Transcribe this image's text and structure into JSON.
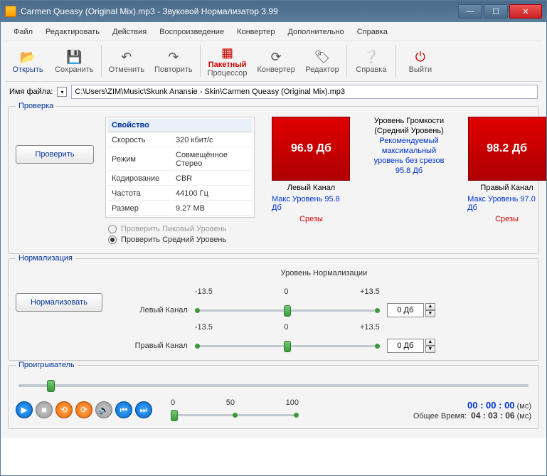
{
  "title": "Carmen Queasy (Original Mix).mp3 - Звуковой Нормализатор 3.99",
  "winbtns": {
    "min": "—",
    "max": "☐",
    "close": "✕"
  },
  "menu": [
    "Файл",
    "Редактировать",
    "Действия",
    "Воспроизведение",
    "Конвертер",
    "Дополнительно",
    "Справка"
  ],
  "toolbar": [
    {
      "label": "Открыть",
      "icon": "📂"
    },
    {
      "label": "Сохранить",
      "icon": "💾"
    },
    {
      "label": "Отменить",
      "icon": "↶"
    },
    {
      "label": "Повторить",
      "icon": "↷"
    },
    {
      "label": "Пакетный",
      "label2": "Процессор",
      "icon": "▦"
    },
    {
      "label": "Конвертер",
      "icon": "⟳"
    },
    {
      "label": "Редактор",
      "icon": "🏷"
    },
    {
      "label": "Справка",
      "icon": "❔"
    },
    {
      "label": "Выйти",
      "icon": "⏻"
    }
  ],
  "file": {
    "label": "Имя файла:",
    "path": "C:\\Users\\ZIM\\Music\\Skunk Anansie - Skin\\Carmen Queasy (Original Mix).mp3"
  },
  "check": {
    "legend": "Проверка",
    "btn": "Проверить",
    "props_header": "Свойство",
    "props": [
      [
        "Скорость",
        "320 кбит/с"
      ],
      [
        "Режим",
        "Совмещённое Стерео"
      ],
      [
        "Кодирование",
        "CBR"
      ],
      [
        "Частота",
        "44100 Гц"
      ],
      [
        "Размер",
        "9.27 MB"
      ]
    ],
    "radio_peak": "Проверить Пиковый Уровень",
    "radio_avg": "Проверить Средний Уровень",
    "left_db": "96.9 Дб",
    "right_db": "98.2 Дб",
    "left_ch": "Левый Канал",
    "right_ch": "Правый Канал",
    "left_max": "Макс Уровень 95.8 Дб",
    "right_max": "Макс Уровень 97.0 Дб",
    "clips": "Срезы",
    "loud_title": "Уровень Громкости",
    "loud_sub": "(Средний Уровень)",
    "loud_rec1": "Рекомендуемый",
    "loud_rec2": "максимальный",
    "loud_rec3": "уровень без срезов",
    "loud_val": "95.8 Дб"
  },
  "norm": {
    "legend": "Нормализация",
    "btn": "Нормализовать",
    "title": "Уровень Нормализации",
    "tick_low": "-13.5",
    "tick_mid": "0",
    "tick_high": "+13.5",
    "left_lbl": "Левый Канал",
    "right_lbl": "Правый Канал",
    "left_val": "0 Дб",
    "right_val": "0 Дб"
  },
  "player": {
    "legend": "Проигрыватель",
    "v0": "0",
    "v50": "50",
    "v100": "100",
    "cur_label_ms": "(мс)",
    "cur_time": "00 : 00 : 00",
    "total_label": "Общее Время:",
    "total_time": "04 : 03 : 06"
  }
}
